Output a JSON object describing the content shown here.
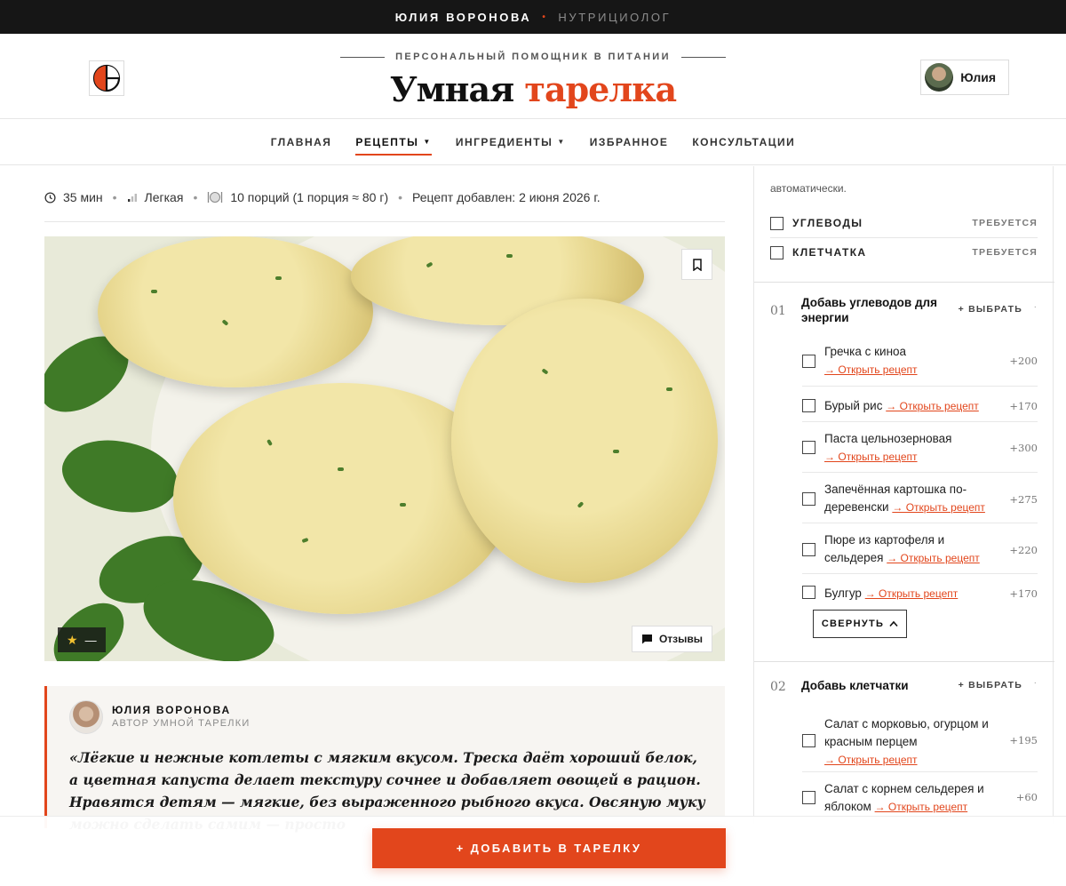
{
  "topbar": {
    "name": "ЮЛИЯ ВОРОНОВА",
    "separator": "•",
    "role": "НУТРИЦИОЛОГ"
  },
  "header": {
    "tagline": "ПЕРСОНАЛЬНЫЙ ПОМОЩНИК В ПИТАНИИ",
    "brand_part1": "Умная",
    "brand_part2": "тарелка",
    "user_name": "Юлия"
  },
  "nav": {
    "items": [
      {
        "label": "ГЛАВНАЯ"
      },
      {
        "label": "РЕЦЕПТЫ",
        "active": true,
        "has_dropdown": true
      },
      {
        "label": "ИНГРЕДИЕНТЫ",
        "has_dropdown": true
      },
      {
        "label": "ИЗБРАННОЕ"
      },
      {
        "label": "КОНСУЛЬТАЦИИ"
      }
    ]
  },
  "recipe": {
    "time": "35 мин",
    "difficulty": "Легкая",
    "portions": "10 порций (1 порция ≈ 80 г)",
    "added": "Рецепт добавлен: 2 июня 2026 г.",
    "rating_label": "—",
    "reviews_label": "Отзывы"
  },
  "author_quote": {
    "name": "ЮЛИЯ ВОРОНОВА",
    "role": "АВТОР УМНОЙ ТАРЕЛКИ",
    "text": "«Лёгкие и нежные котлеты с мягким вкусом. Треска даёт хороший белок, а цветная капуста делает текстуру сочнее и добавляет овощей в рацион. Нравятся детям — мягкие, без выраженного рыбного вкуса. Овсяную муку можно сделать самим — просто"
  },
  "sidebar": {
    "note": "автоматически.",
    "nutrients": [
      {
        "label": "УГЛЕВОДЫ",
        "status": "ТРЕБУЕТСЯ"
      },
      {
        "label": "КЛЕТЧАТКА",
        "status": "ТРЕБУЕТСЯ"
      }
    ],
    "groups": [
      {
        "number": "01",
        "title": "Добавь углеводов для энергии",
        "choose": "+ ВЫБРАТЬ",
        "dot": "·",
        "options": [
          {
            "name": "Гречка с киноа",
            "link": "→ Открыть рецепт",
            "kcal": "+200"
          },
          {
            "name": "Бурый рис",
            "link": "→ Открыть рецепт",
            "kcal": "+170"
          },
          {
            "name": "Паста цельнозерновая",
            "link": "→ Открыть рецепт",
            "kcal": "+300"
          },
          {
            "name": "Запечённая картошка по-деревенски",
            "link": "→ Открыть рецепт",
            "kcal": "+275"
          },
          {
            "name": "Пюре из картофеля и сельдерея",
            "link": "→ Открыть рецепт",
            "kcal": "+220"
          },
          {
            "name": "Булгур",
            "link": "→ Открыть рецепт",
            "kcal": "+170"
          }
        ],
        "collapse_label": "СВЕРНУТЬ"
      },
      {
        "number": "02",
        "title": "Добавь клетчатки",
        "choose": "+ ВЫБРАТЬ",
        "dot": "·",
        "options": [
          {
            "name": "Салат с морковью, огурцом и красным перцем",
            "link": "→ Открыть рецепт",
            "kcal": "+195"
          },
          {
            "name": "Салат с корнем сельдерея и яблоком",
            "link": "→ Открыть рецепт",
            "kcal": "+60"
          }
        ]
      }
    ]
  },
  "cta": {
    "label": "+ ДОБАВИТЬ В ТАРЕЛКУ"
  },
  "colors": {
    "accent": "#e2461c",
    "topbar": "#161616",
    "quote_bg": "#f7f5f2"
  }
}
